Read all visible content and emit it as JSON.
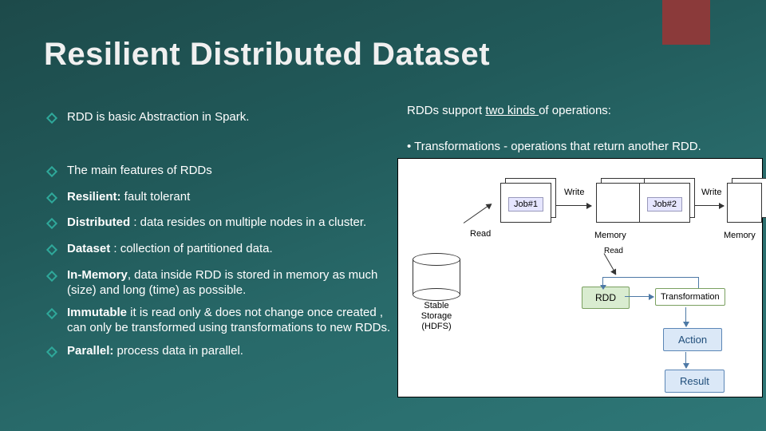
{
  "title": "Resilient Distributed Dataset",
  "left": {
    "b0": "RDD is basic Abstraction in Spark.",
    "b1": "The main features of RDDs",
    "b2_strong": "Resilient:",
    "b2_rest": "  fault tolerant",
    "b3_strong": "Distributed",
    "b3_rest": " : data resides on multiple nodes in a cluster.",
    "b4_strong": "Dataset",
    "b4_rest": " : collection of  partitioned data.",
    "b5_strong": "In-Memory",
    "b5_rest": ", data inside RDD is stored in memory as much (size) and long (time) as possible.",
    "b6_strong": "Immutable",
    "b6_rest": "  it is read only & does not change once created , can only be transformed using transformations to new RDDs.",
    "b7_strong": "Parallel:",
    "b7_rest": " process data in parallel."
  },
  "right": {
    "intro_pre": "RDDs support ",
    "intro_u": "two kinds ",
    "intro_post": "of operations:",
    "line2": "• Transformations - operations that return another RDD."
  },
  "diagram": {
    "hdfs_l1": "Stable",
    "hdfs_l2": "Storage",
    "hdfs_l3": "(HDFS)",
    "read": "Read",
    "job1": "Job#1",
    "job2": "Job#2",
    "write": "Write",
    "memory": "Memory",
    "rdd": "RDD",
    "transformation": "Transformation",
    "action": "Action",
    "result": "Result"
  }
}
